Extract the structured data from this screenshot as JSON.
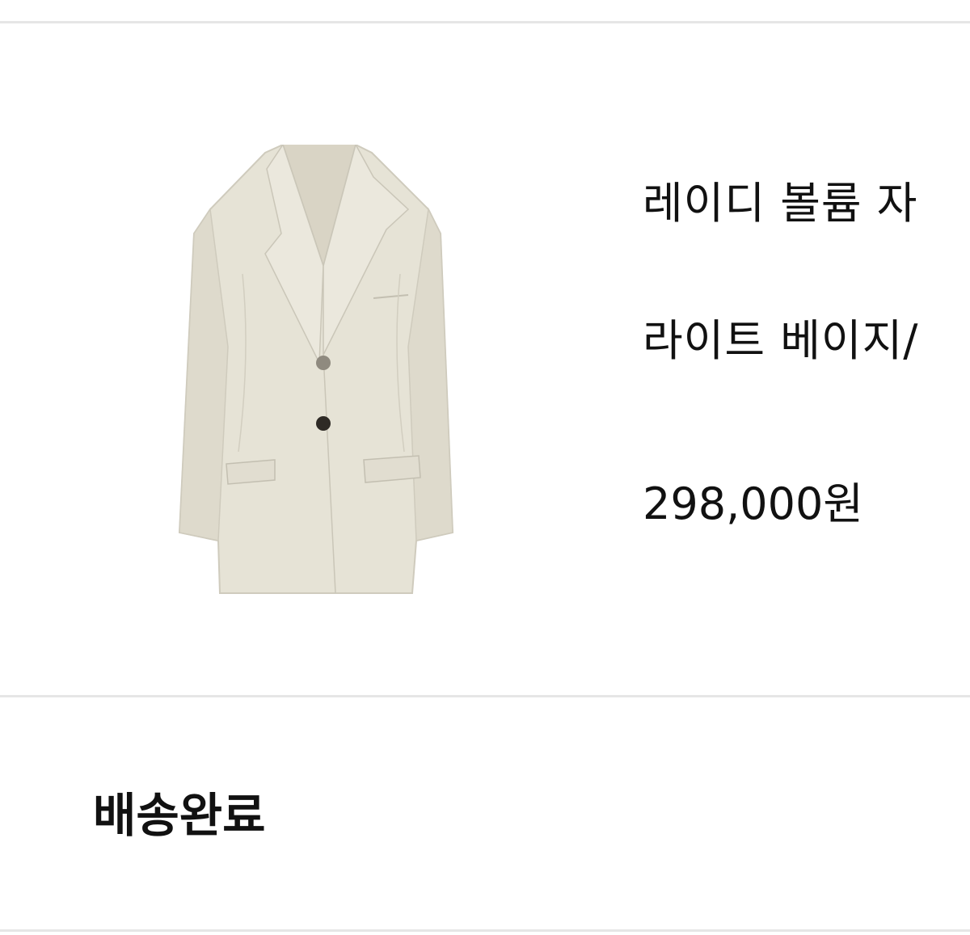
{
  "order_item": {
    "image_alt": "jacket",
    "name": "레이디 볼륨 자",
    "option": "라이트 베이지/",
    "price": "298,000원"
  },
  "delivery": {
    "status": "배송완료"
  },
  "colors": {
    "jacket": "#e6e3d6",
    "divider": "#e6e6e6",
    "text": "#111111"
  }
}
